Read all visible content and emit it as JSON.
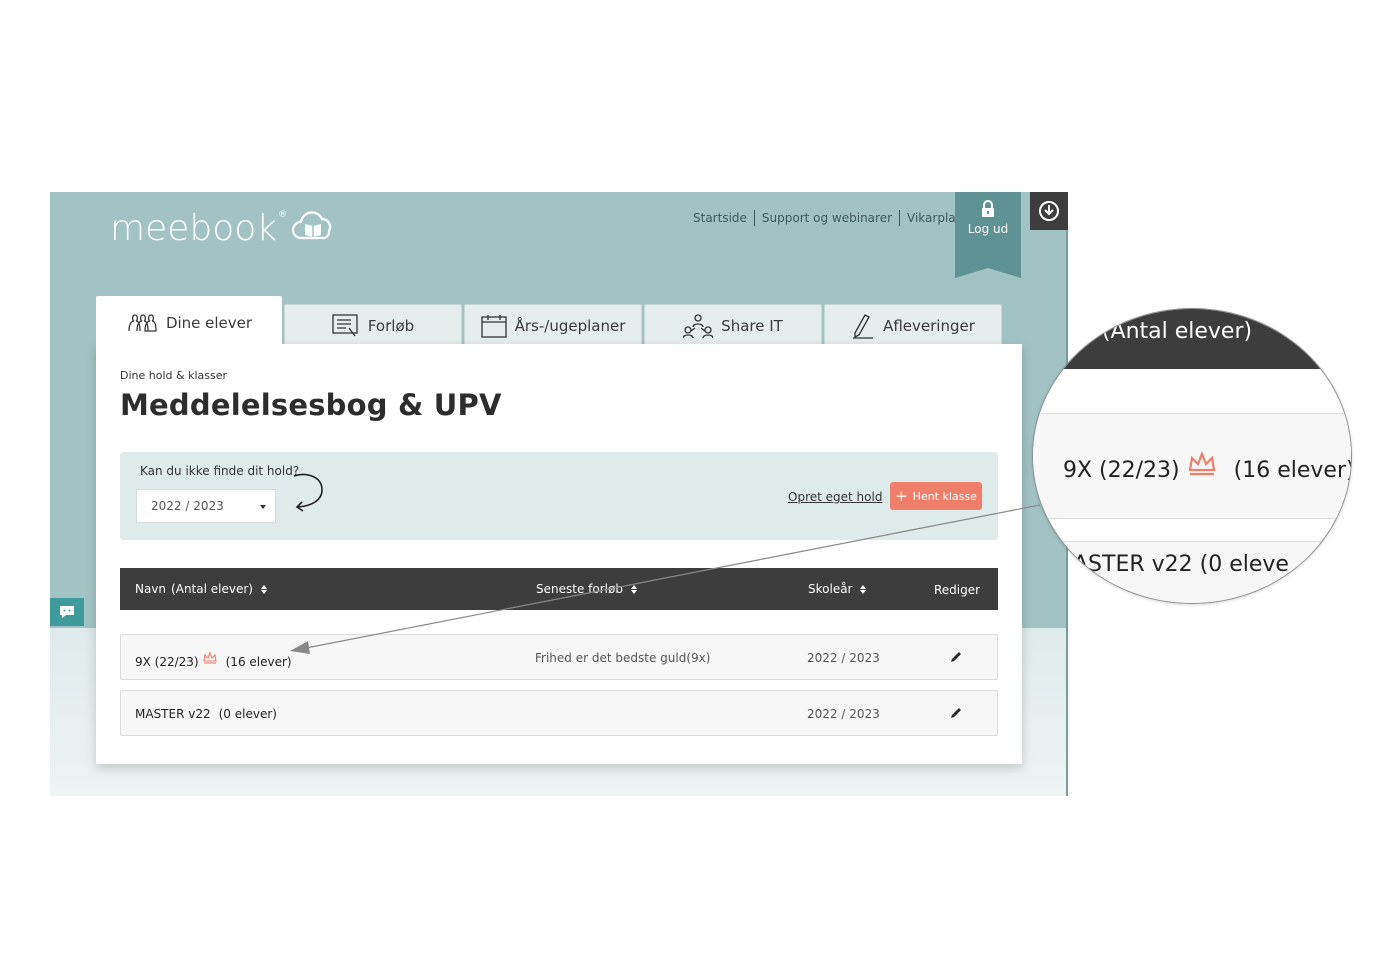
{
  "brand": {
    "name": "meebook",
    "reg": "®"
  },
  "topnav": {
    "items": [
      "Startside",
      "Support og webinarer",
      "Vikarplan"
    ],
    "logout": "Log ud"
  },
  "tabs": [
    "Dine elever",
    "Forløb",
    "Års-/ugeplaner",
    "Share IT",
    "Afleveringer"
  ],
  "page": {
    "breadcrumb": "Dine hold & klasser",
    "title": "Meddelelsesbog & UPV"
  },
  "finder": {
    "question": "Kan du ikke finde dit hold?",
    "year_selected": "2022 / 2023",
    "create_link": "Opret eget hold",
    "fetch_button": "Hent klasse"
  },
  "table": {
    "headers": {
      "name": "Navn",
      "count": "(Antal elever)",
      "latest": "Seneste forløb",
      "year": "Skoleår",
      "edit": "Rediger"
    },
    "rows": [
      {
        "name": "9X (22/23)",
        "count": "(16 elever)",
        "latest": "Frihed er det bedste guld(9x)",
        "year": "2022 / 2023"
      },
      {
        "name": "MASTER v22",
        "count": "(0 elever)",
        "latest": "",
        "year": "2022 / 2023"
      }
    ]
  },
  "magnifier": {
    "header": "n  (Antal elever)",
    "row1_name": "9X (22/23)",
    "row1_count": "(16 elever)",
    "row2": "ASTER v22   (0 eleve"
  },
  "colors": {
    "teal_bg": "#a2c3c4",
    "header_dark": "#3d3d3d",
    "accent": "#ef7f6b",
    "logout": "#5f9293"
  },
  "icons": [
    "cloud-book-icon",
    "lock-icon",
    "download-icon",
    "students-icon",
    "course-icon",
    "calendar-icon",
    "share-icon",
    "pen-icon",
    "crown-icon",
    "pencil-icon",
    "chat-icon"
  ]
}
